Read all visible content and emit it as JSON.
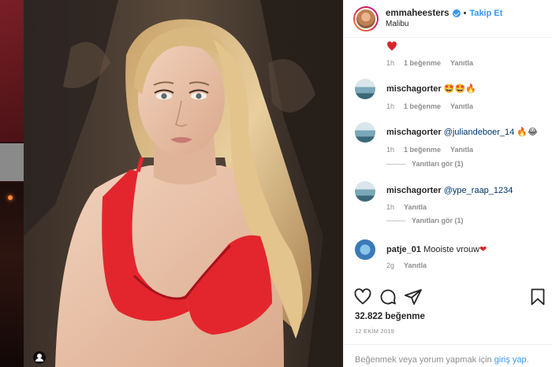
{
  "post": {
    "username": "emmaheesters",
    "separator": "•",
    "follow_label": "Takip Et",
    "location": "Malibu"
  },
  "top_comment": {
    "time": "1h",
    "likes": "1 beğenme",
    "reply": "Yanıtla"
  },
  "comments": [
    {
      "user": "mischagorter",
      "text": "",
      "mention": "",
      "emoji": "🤩🤩🔥",
      "time": "1h",
      "likes": "1 beğenme",
      "reply": "Yanıtla",
      "view_replies": ""
    },
    {
      "user": "mischagorter",
      "text": "",
      "mention": "@juliandeboer_14",
      "emoji": "🔥😂",
      "time": "1h",
      "likes": "1 beğenme",
      "reply": "Yanıtla",
      "view_replies": "Yanıtları gör (1)"
    },
    {
      "user": "mischagorter",
      "text": "",
      "mention": "@ype_raap_1234",
      "emoji": "",
      "time": "1h",
      "likes": "",
      "reply": "Yanıtla",
      "view_replies": "Yanıtları gör (1)"
    },
    {
      "user": "patje_01",
      "text": "Mooiste vrouw",
      "mention": "",
      "emoji": "❤",
      "time": "2g",
      "likes": "",
      "reply": "Yanıtla",
      "view_replies": ""
    }
  ],
  "likes_count": "32.822 beğenme",
  "post_date": "12 EKİM 2019",
  "login_prompt": {
    "text": "Beğenmek veya yorum yapmak için ",
    "link": "giriş yap",
    "end": "."
  },
  "colors": {
    "link_blue": "#3897f0",
    "heart_red": "#ed4956",
    "muted_gray": "#8e8e8e"
  },
  "icons": [
    "user-tag-icon",
    "verified-icon",
    "heart-icon",
    "comment-icon",
    "share-icon",
    "bookmark-icon"
  ]
}
